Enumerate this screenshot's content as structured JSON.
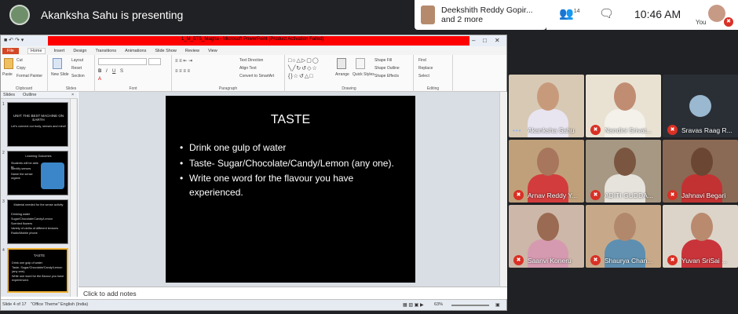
{
  "meet": {
    "presenter_text": "Akanksha Sahu is presenting",
    "participants_name": "Deekshith Reddy Gopir...",
    "participants_more": "and 2 more",
    "people_count": "14",
    "time": "10:46 AM",
    "you_label": "You"
  },
  "ppt": {
    "window_title": "1_M_ET5_Magna - Microsoft PowerPoint (Product Activation Failed)",
    "tabs": [
      "File",
      "Home",
      "Insert",
      "Design",
      "Transitions",
      "Animations",
      "Slide Show",
      "Review",
      "View"
    ],
    "ribbon_groups": [
      "Clipboard",
      "Slides",
      "Font",
      "Paragraph",
      "Drawing",
      "Editing"
    ],
    "ribbon_labels": {
      "paste": "Paste",
      "cut": "Cut",
      "copy": "Copy",
      "format_painter": "Format Painter",
      "new_slide": "New Slide",
      "layout": "Layout",
      "reset": "Reset",
      "section": "Section",
      "text_direction": "Text Direction",
      "align_text": "Align Text",
      "convert_smartart": "Convert to SmartArt",
      "arrange": "Arrange",
      "quick_styles": "Quick Styles",
      "shape_fill": "Shape Fill",
      "shape_outline": "Shape Outline",
      "shape_effects": "Shape Effects",
      "find": "Find",
      "replace": "Replace",
      "select": "Select"
    },
    "panel_tabs": [
      "Slides",
      "Outline"
    ],
    "thumbnails": [
      {
        "num": "1",
        "title": "UNIT: THE BEST MACHINE ON EARTH",
        "lines": [
          "Let's connect our body, senses and mind!"
        ]
      },
      {
        "num": "2",
        "title": "Learning Outcomes",
        "lines": [
          "Students will be able to:",
          "Identify senses",
          "Name the sense organs"
        ]
      },
      {
        "num": "3",
        "title": "Material needed for the sense activity",
        "lines": [
          "Drinking water",
          "Sugar/Chocolate/Candy/Lemon",
          "Scented flowers",
          "Variety of cloths of different textures",
          "Radio/Mobile phone"
        ]
      },
      {
        "num": "4",
        "title": "TASTE",
        "lines": [
          "Drink one gulp of water",
          "Taste- Sugar/Chocolate/Candy/Lemon (any one).",
          "Write one word for the flavour you have experienced."
        ]
      }
    ],
    "slide": {
      "title": "TASTE",
      "bullets": [
        "Drink one gulp of water",
        "Taste- Sugar/Chocolate/Candy/Lemon (any one).",
        "Write one word for the flavour you have experienced."
      ]
    },
    "notes_placeholder": "Click to add notes",
    "status": {
      "slide_info": "Slide 4 of 17",
      "theme": "\"Office Theme\"",
      "language": "English (India)",
      "zoom": "63%"
    }
  },
  "tiles": [
    {
      "name": "Akanksha Sahu",
      "bg": "#d7c9b4",
      "face": "#c89a7c",
      "body": "#e8e4f0",
      "status": "speaking"
    },
    {
      "name": "Nandini Srivat...",
      "bg": "#e9e2d3",
      "face": "#c08d73",
      "body": "#f4f0ea",
      "status": "muted"
    },
    {
      "name": "Sravas Raag R...",
      "bg": "#2a2f36",
      "face": "",
      "body": "",
      "status": "muted"
    },
    {
      "name": "Arnav Reddy Y...",
      "bg": "#bfa07a",
      "face": "#a7765c",
      "body": "#d33c3c",
      "status": "muted"
    },
    {
      "name": "ADITI GUDDA...",
      "bg": "#a79883",
      "face": "#7a5640",
      "body": "#e6e2dc",
      "status": "muted"
    },
    {
      "name": "Jahnavi Begari",
      "bg": "#8a6a55",
      "face": "#6b4733",
      "body": "#c33232",
      "status": "muted"
    },
    {
      "name": "Saanvi Koneru",
      "bg": "#cdb7a8",
      "face": "#9a6a52",
      "body": "#d59ab0",
      "status": "muted"
    },
    {
      "name": "Shaurya Chan...",
      "bg": "#c7a98a",
      "face": "#b2886c",
      "body": "#5e8fb0",
      "status": "muted"
    },
    {
      "name": "Yuvan SriSai ...",
      "bg": "#dcd4c8",
      "face": "#b98a6e",
      "body": "#c9343a",
      "status": "muted"
    }
  ]
}
